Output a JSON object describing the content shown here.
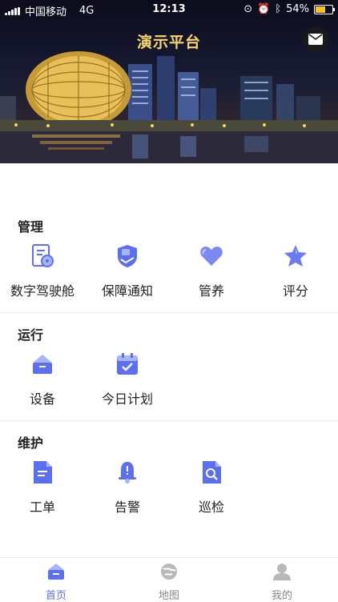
{
  "status_bar": {
    "carrier": "中国移动",
    "network": "4G",
    "time": "12:13",
    "battery": "54%"
  },
  "header": {
    "title": "演示平台"
  },
  "sections": [
    {
      "label": "管理",
      "items": [
        {
          "label": "数字驾驶舱",
          "icon": "dashboard-icon"
        },
        {
          "label": "保障通知",
          "icon": "shield-notice-icon"
        },
        {
          "label": "管养",
          "icon": "heart-icon"
        },
        {
          "label": "评分",
          "icon": "star-icon"
        }
      ]
    },
    {
      "label": "运行",
      "items": [
        {
          "label": "设备",
          "icon": "device-icon"
        },
        {
          "label": "今日计划",
          "icon": "calendar-icon"
        }
      ]
    },
    {
      "label": "维护",
      "items": [
        {
          "label": "工单",
          "icon": "work-order-icon"
        },
        {
          "label": "告警",
          "icon": "alarm-bell-icon"
        },
        {
          "label": "巡检",
          "icon": "inspection-icon"
        }
      ]
    }
  ],
  "tabbar": [
    {
      "label": "首页",
      "icon": "home-icon",
      "active": true
    },
    {
      "label": "地图",
      "icon": "map-icon",
      "active": false
    },
    {
      "label": "我的",
      "icon": "profile-icon",
      "active": false
    }
  ],
  "colors": {
    "accent": "#5c6ff0",
    "accent_light": "#a9b4f7",
    "title_gold": "#f7d76b"
  }
}
